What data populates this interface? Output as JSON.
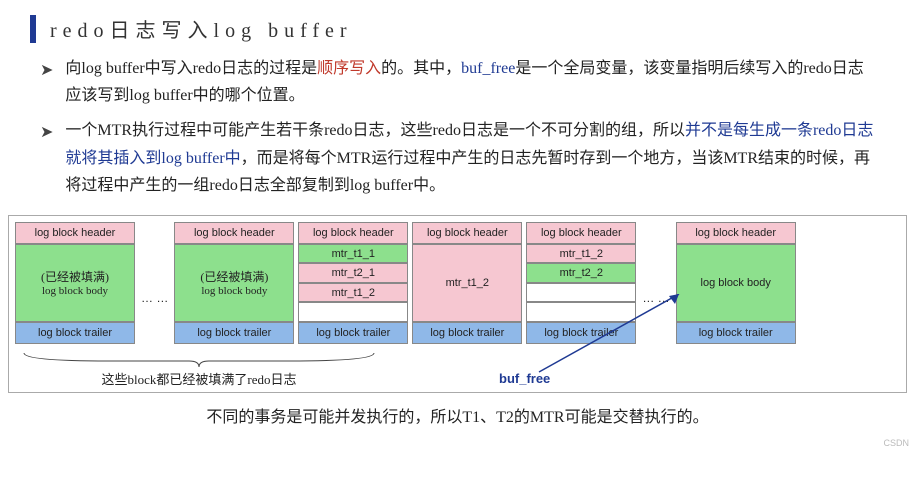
{
  "title": "redo日志写入log buffer",
  "bullet1": {
    "t1": "向log buffer中写入redo日志的过程是",
    "red": "顺序写入",
    "t2": "的。其中，",
    "buf": "buf_free",
    "t3": "是一个全局变量，该变量指明后续写入的redo日志应该写到log buffer中的哪个位置。"
  },
  "bullet2": {
    "t1": "一个MTR执行过程中可能产生若干条redo日志，这些redo日志是一个不可分割的组，所以",
    "blue": "并不是每生成一条redo日志就将其插入到log buffer中",
    "t2": "，而是将每个MTR运行过程中产生的日志先暂时存到一个地方，当该MTR结束的时候，再将过程中产生的一组redo日志全部复制到log buffer中。"
  },
  "blk": {
    "header": "log block header",
    "body": "log block body",
    "trailer": "log block trailer",
    "filled": "(已经被填满)",
    "mtr_t11": "mtr_t1_1",
    "mtr_t21": "mtr_t2_1",
    "mtr_t12": "mtr_t1_2",
    "mtr_t22": "mtr_t2_2"
  },
  "brace_label": "这些block都已经被填满了redo日志",
  "buf_free": "buf_free",
  "bottom": "不同的事务是可能并发执行的，所以T1、T2的MTR可能是交替执行的。",
  "ellipsis": "… …"
}
